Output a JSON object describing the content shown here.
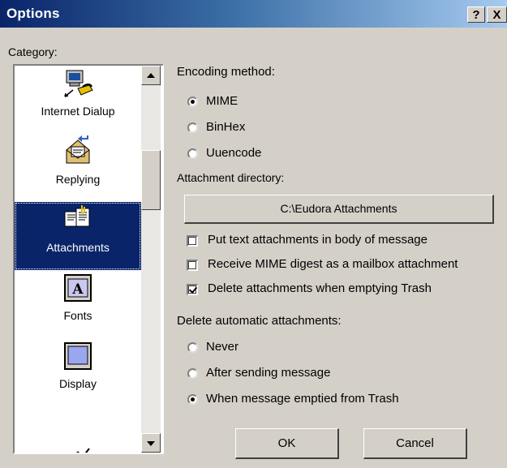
{
  "window": {
    "title": "Options",
    "help_label": "?",
    "close_label": "X"
  },
  "category_label": "Category:",
  "categories": [
    {
      "label": "Internet Dialup",
      "icon": "internet-dialup-icon",
      "selected": false
    },
    {
      "label": "Replying",
      "icon": "replying-icon",
      "selected": false
    },
    {
      "label": "Attachments",
      "icon": "attachments-icon",
      "selected": true
    },
    {
      "label": "Fonts",
      "icon": "fonts-icon",
      "selected": false
    },
    {
      "label": "Display",
      "icon": "display-icon",
      "selected": false
    }
  ],
  "encoding": {
    "label": "Encoding method:",
    "options": [
      {
        "label": "MIME",
        "selected": true
      },
      {
        "label": "BinHex",
        "selected": false
      },
      {
        "label": "Uuencode",
        "selected": false
      }
    ]
  },
  "attachment_directory": {
    "label": "Attachment directory:",
    "value": "C:\\Eudora Attachments"
  },
  "checkboxes": [
    {
      "label": "Put text attachments in body of message",
      "checked": false
    },
    {
      "label": "Receive MIME digest as a mailbox attachment",
      "checked": false
    },
    {
      "label": "Delete attachments when emptying Trash",
      "checked": true
    }
  ],
  "delete_automatic": {
    "label": "Delete automatic attachments:",
    "options": [
      {
        "label": "Never",
        "selected": false
      },
      {
        "label": "After sending message",
        "selected": false
      },
      {
        "label": "When message emptied from Trash",
        "selected": true
      }
    ]
  },
  "buttons": {
    "ok": "OK",
    "cancel": "Cancel"
  }
}
